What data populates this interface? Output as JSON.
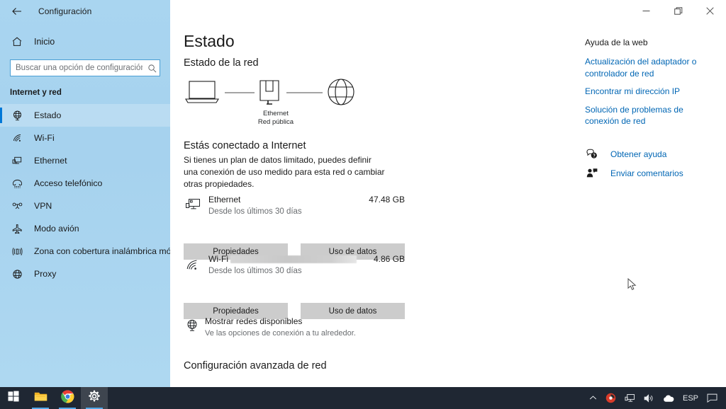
{
  "window": {
    "title": "Configuración",
    "back_icon": "back-arrow-icon",
    "controls": {
      "minimize": "–",
      "maximize": "❐",
      "close": "✕"
    }
  },
  "sidebar": {
    "home_label": "Inicio",
    "home_icon": "home-icon",
    "search": {
      "placeholder": "Buscar una opción de configuración",
      "value": "",
      "icon": "search-icon"
    },
    "group_title": "Internet y red",
    "items": [
      {
        "label": "Estado",
        "icon": "globe-status-icon",
        "selected": true
      },
      {
        "label": "Wi-Fi",
        "icon": "wifi-icon",
        "selected": false
      },
      {
        "label": "Ethernet",
        "icon": "ethernet-icon",
        "selected": false
      },
      {
        "label": "Acceso telefónico",
        "icon": "dialup-phone-icon",
        "selected": false
      },
      {
        "label": "VPN",
        "icon": "vpn-icon",
        "selected": false
      },
      {
        "label": "Modo avión",
        "icon": "airplane-icon",
        "selected": false
      },
      {
        "label": "Zona con cobertura inalámbrica móvil",
        "icon": "hotspot-icon",
        "selected": false
      },
      {
        "label": "Proxy",
        "icon": "proxy-globe-icon",
        "selected": false
      }
    ]
  },
  "main": {
    "page_title": "Estado",
    "section_title": "Estado de la red",
    "diagram": {
      "device_icon": "laptop-icon",
      "network_icon": "ethernet-port-icon",
      "internet_icon": "globe-icon",
      "caption_line1": "Ethernet",
      "caption_line2": "Red pública"
    },
    "connected_title": "Estás conectado a Internet",
    "connected_desc": "Si tienes un plan de datos limitado, puedes definir una conexión de uso medido para esta red o cambiar otras propiedades.",
    "adapters": [
      {
        "name": "Ethernet",
        "name_redacted": false,
        "icon": "ethernet-monitor-icon",
        "since": "Desde los últimos 30 días",
        "usage": "47.48 GB",
        "properties_label": "Propiedades",
        "data_usage_label": "Uso de datos"
      },
      {
        "name": "Wi-Fi",
        "name_redacted": true,
        "icon": "wifi-signal-icon",
        "since": "Desde los últimos 30 días",
        "usage": "4.86 GB",
        "properties_label": "Propiedades",
        "data_usage_label": "Uso de datos"
      }
    ],
    "show_networks": {
      "icon": "available-networks-globe-icon",
      "title": "Mostrar redes disponibles",
      "subtitle": "Ve las opciones de conexión a tu alrededor."
    },
    "advanced_title": "Configuración avanzada de red"
  },
  "help": {
    "heading": "Ayuda de la web",
    "links": [
      "Actualización del adaptador o controlador de red",
      "Encontrar mi dirección IP",
      "Solución de problemas de conexión de red"
    ],
    "actions": [
      {
        "label": "Obtener ayuda",
        "icon": "question-bubble-icon"
      },
      {
        "label": "Enviar comentarios",
        "icon": "feedback-person-icon"
      }
    ]
  },
  "taskbar": {
    "items": [
      {
        "name": "start-button",
        "icon": "windows-logo-icon",
        "active": false,
        "running": false
      },
      {
        "name": "file-explorer-button",
        "icon": "folder-icon",
        "active": false,
        "running": true
      },
      {
        "name": "chrome-button",
        "icon": "chrome-icon",
        "active": false,
        "running": true
      },
      {
        "name": "settings-button",
        "icon": "gear-icon",
        "active": true,
        "running": true
      }
    ],
    "tray": {
      "chevron": "chevron-up-icon",
      "icons": [
        "security-shield-icon",
        "network-icon",
        "volume-icon",
        "onedrive-cloud-icon"
      ],
      "language": "ESP",
      "notifications": "notification-icon"
    }
  },
  "colors": {
    "sidebar_bg": "#a8d4ef",
    "accent": "#0078d7",
    "link": "#0066b4",
    "taskbar_bg": "#1f2733",
    "button_bg": "#cccccc"
  }
}
